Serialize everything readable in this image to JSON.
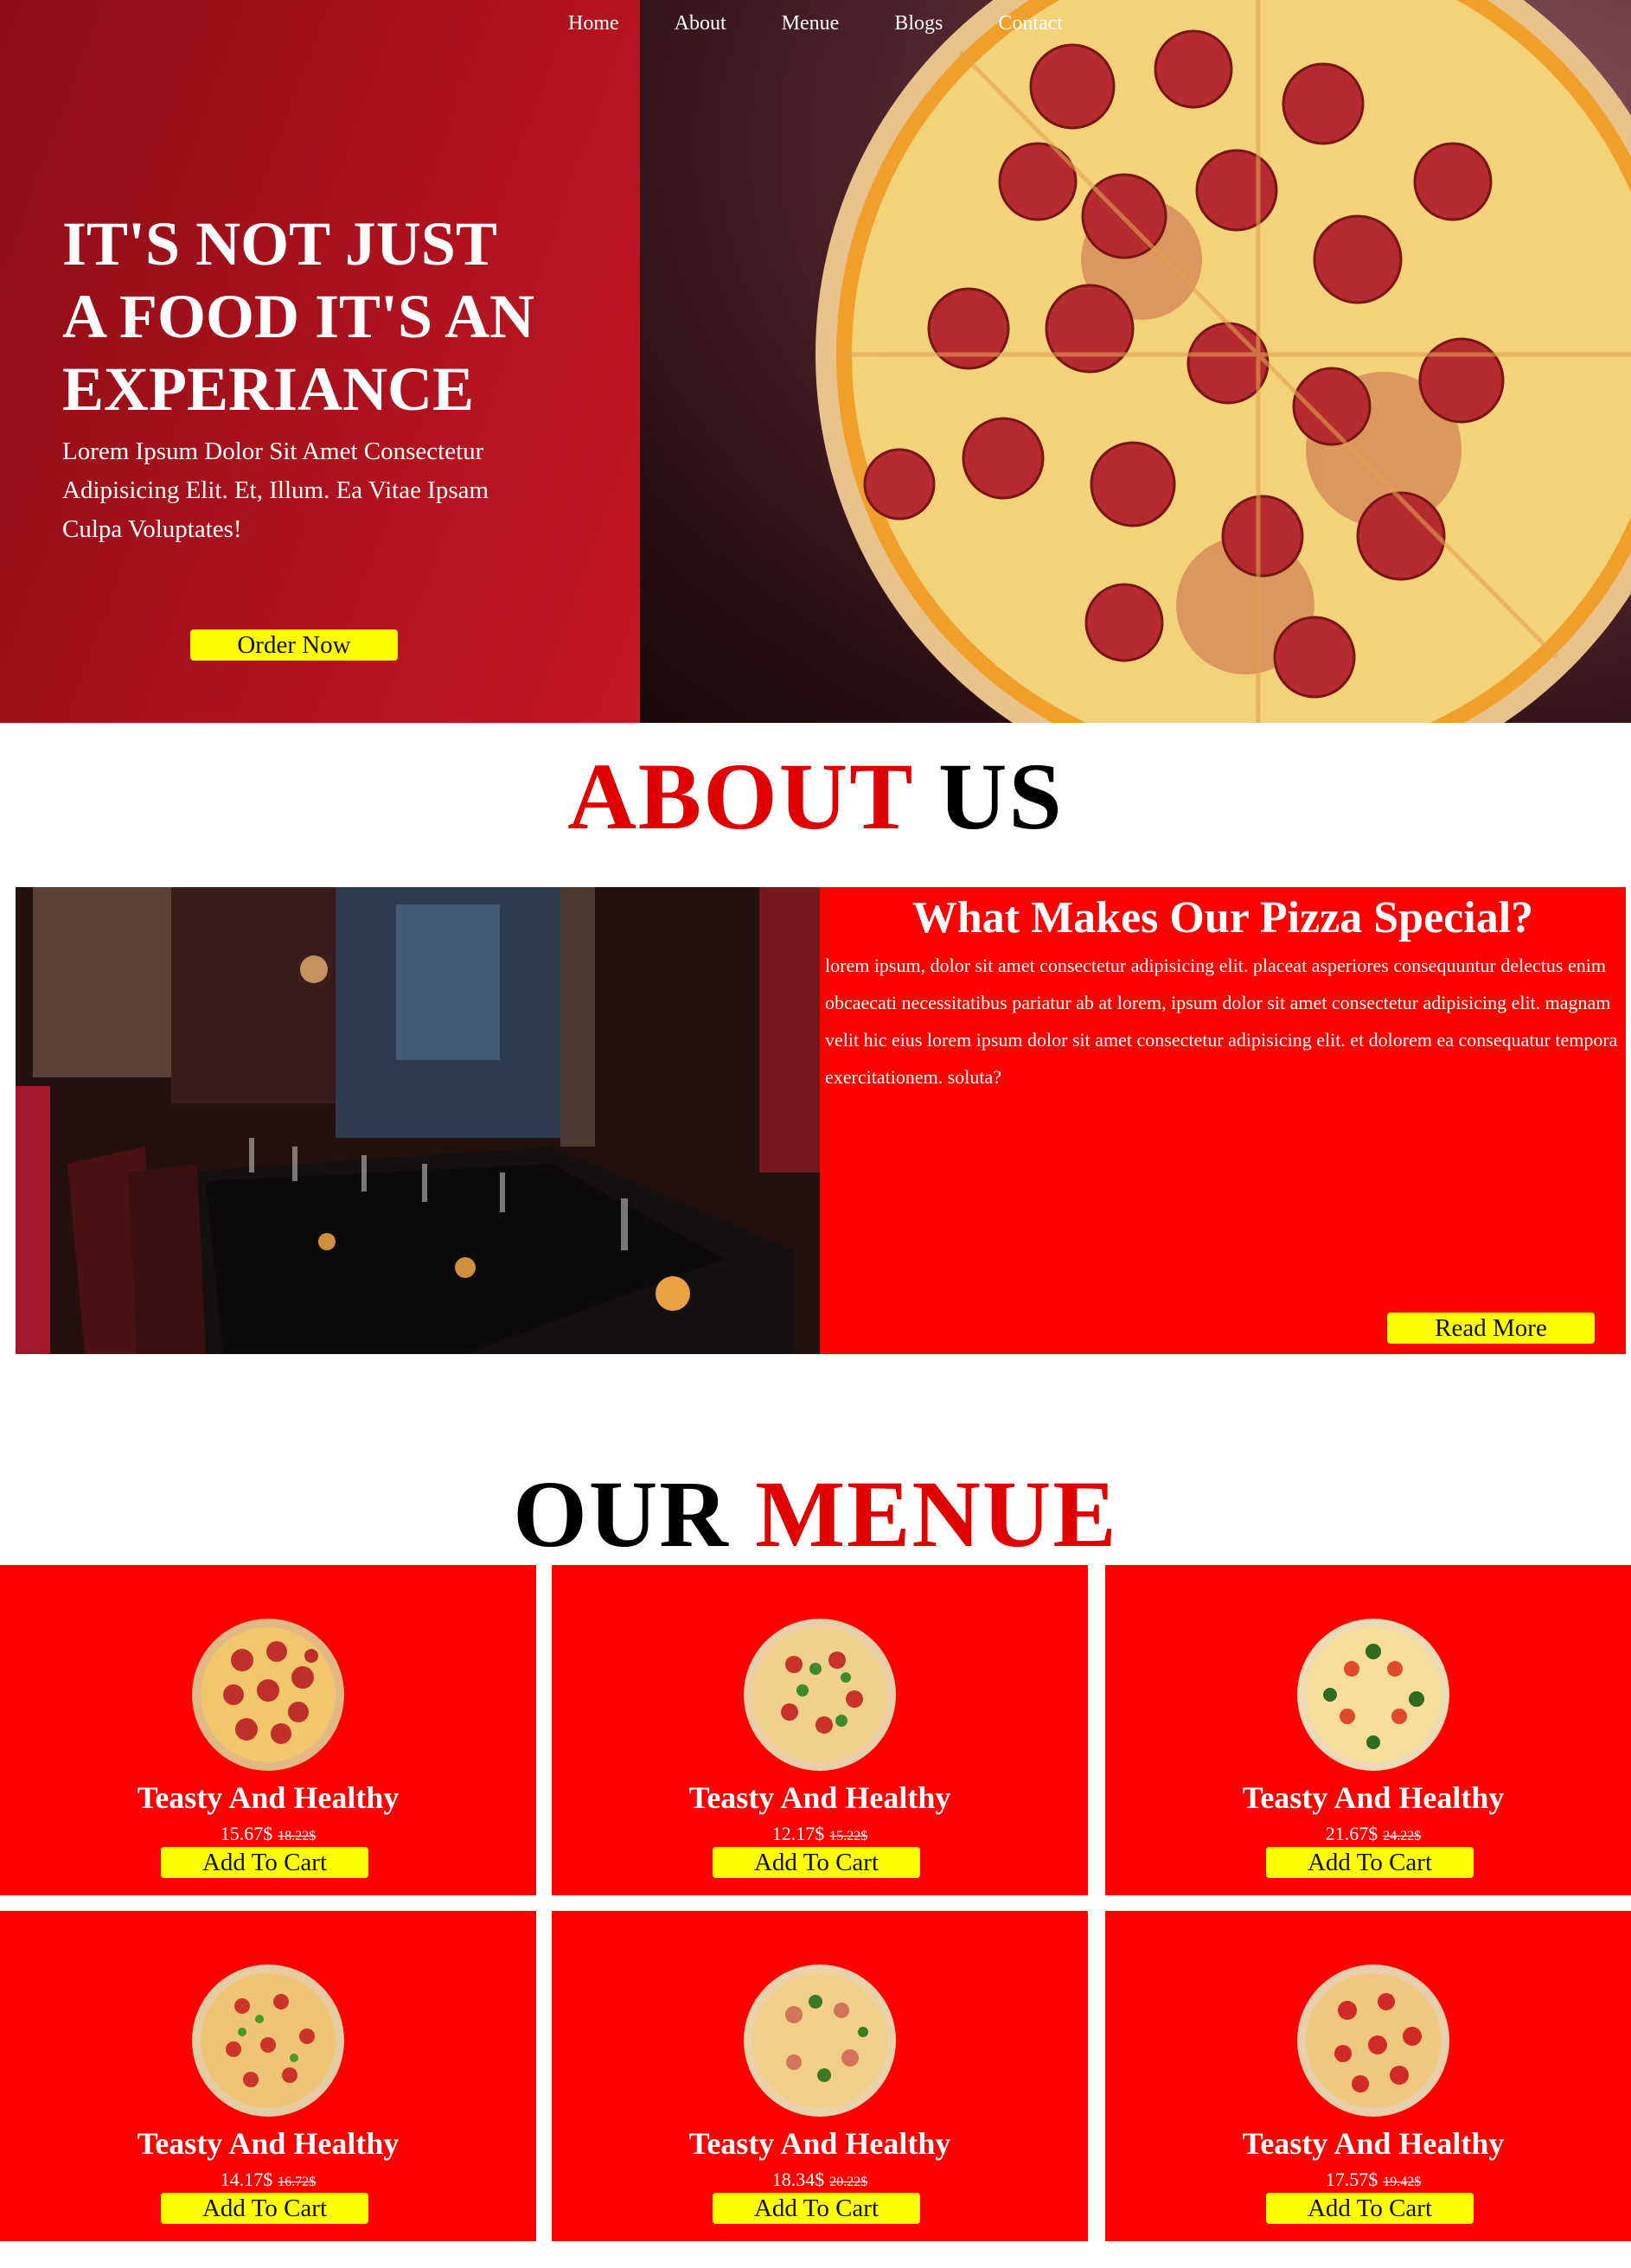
{
  "nav": {
    "items": [
      "Home",
      "About",
      "Menue",
      "Blogs",
      "Contact"
    ]
  },
  "hero": {
    "title": "IT'S NOT JUST A FOOD IT'S AN EXPERIANCE",
    "subtitle": "Lorem Ipsum Dolor Sit Amet Consectetur Adipisicing Elit. Et, Illum. Ea Vitae Ipsam Culpa Voluptates!",
    "cta": "Order Now"
  },
  "about": {
    "title_a": "ABOUT",
    "title_b": "US",
    "heading": "What Makes Our Pizza Special?",
    "text": "lorem ipsum, dolor sit amet consectetur adipisicing elit. placeat asperiores consequuntur delectus enim obcaecati necessitatibus pariatur ab at lorem, ipsum dolor sit amet consectetur adipisicing elit. magnam velit hic eius lorem ipsum dolor sit amet consectetur adipisicing elit. et dolorem ea consequatur tempora exercitationem. soluta?",
    "button": "Read More"
  },
  "menu": {
    "title_a": "OUR",
    "title_b": "MENUE",
    "items": [
      {
        "name": "Teasty And Healthy",
        "price": "15.67$",
        "old_price": "18.22$",
        "button": "Add To Cart"
      },
      {
        "name": "Teasty And Healthy",
        "price": "12.17$",
        "old_price": "15.22$",
        "button": "Add To Cart"
      },
      {
        "name": "Teasty And Healthy",
        "price": "21.67$",
        "old_price": "24.22$",
        "button": "Add To Cart"
      },
      {
        "name": "Teasty And Healthy",
        "price": "14.17$",
        "old_price": "16.72$",
        "button": "Add To Cart"
      },
      {
        "name": "Teasty And Healthy",
        "price": "18.34$",
        "old_price": "20.22$",
        "button": "Add To Cart"
      },
      {
        "name": "Teasty And Healthy",
        "price": "17.57$",
        "old_price": "19.42$",
        "button": "Add To Cart"
      }
    ]
  },
  "colors": {
    "brand_red": "#ff0000",
    "button_yellow": "#ffff00",
    "hero_red": "#c21622"
  }
}
